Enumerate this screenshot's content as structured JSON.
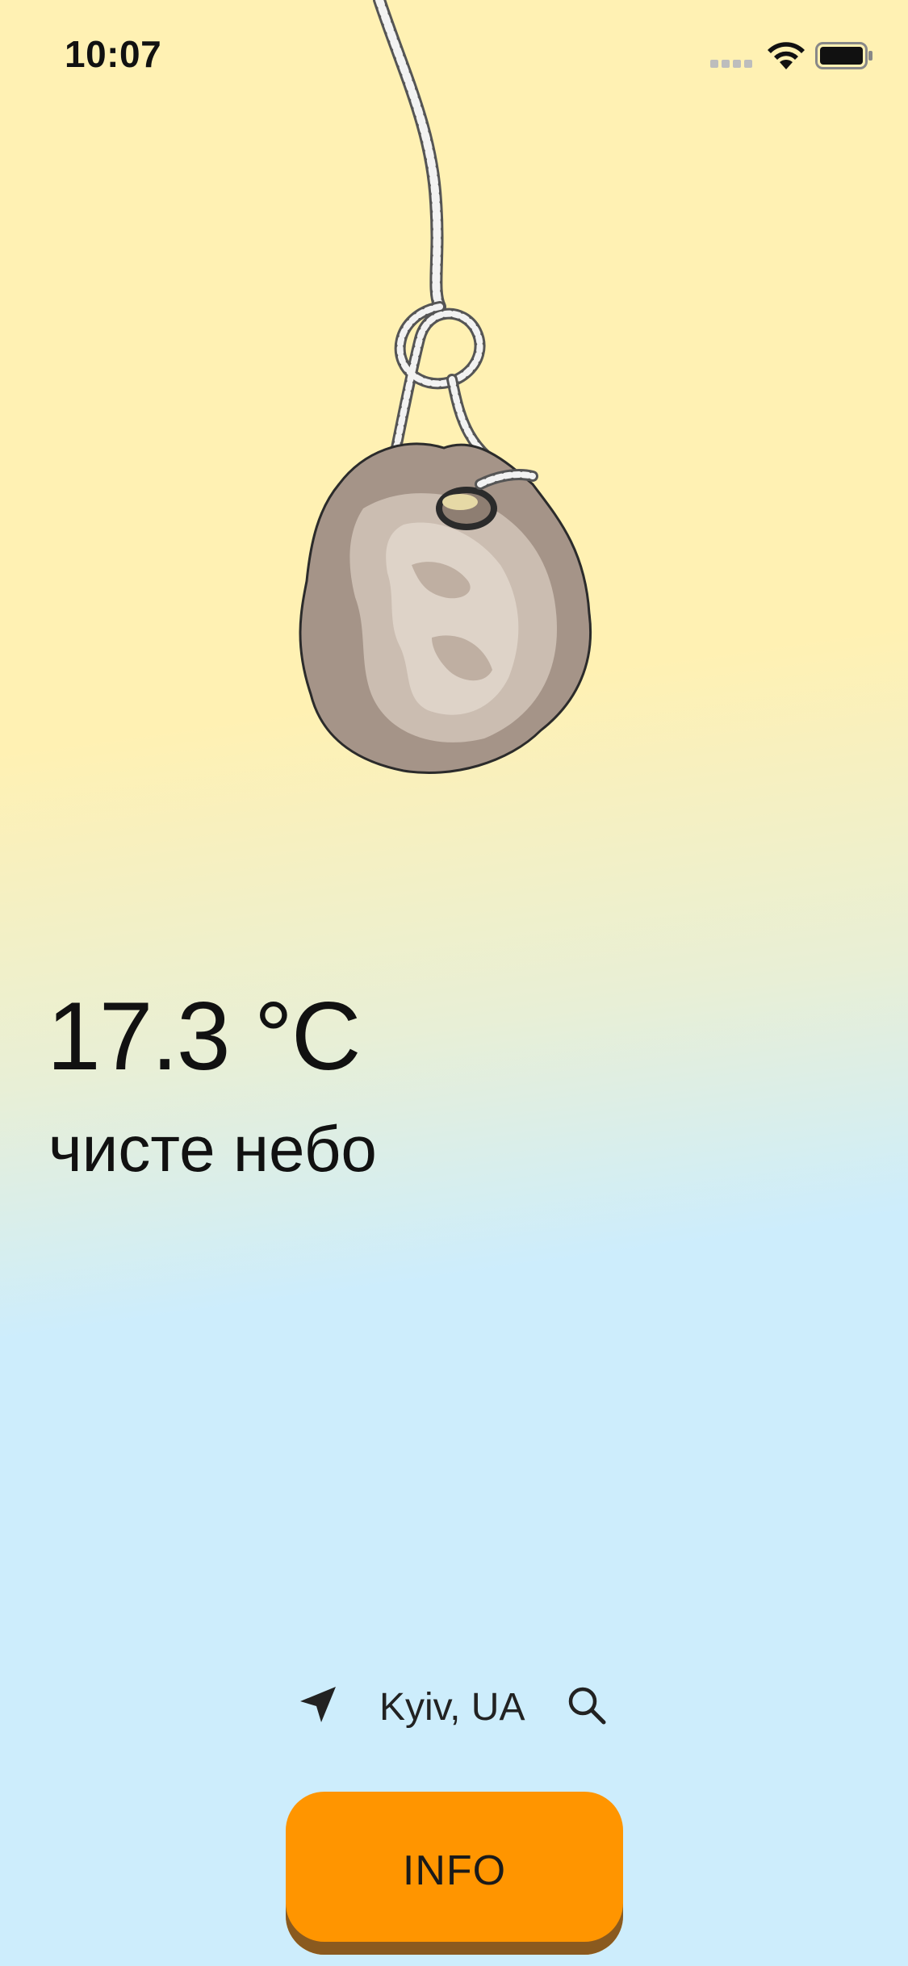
{
  "status_bar": {
    "time": "10:07",
    "icons": [
      "signal-icon",
      "wifi-icon",
      "battery-icon"
    ]
  },
  "illustration": {
    "name": "weather-stone-on-rope",
    "colors": {
      "stone": "#A59488",
      "stone_light": "#D6CBC0",
      "rope": "#FFFFFF"
    }
  },
  "weather": {
    "temperature": "17.3 °C",
    "description": "чисте небо"
  },
  "location": {
    "icon": "location-arrow-icon",
    "city": "Kyiv, UA",
    "search_icon": "search-icon"
  },
  "info_button": {
    "label": "INFO",
    "color": "#FF9500"
  },
  "colors": {
    "background_top": "#FFF1B3",
    "background_bottom": "#CDEDFC"
  }
}
